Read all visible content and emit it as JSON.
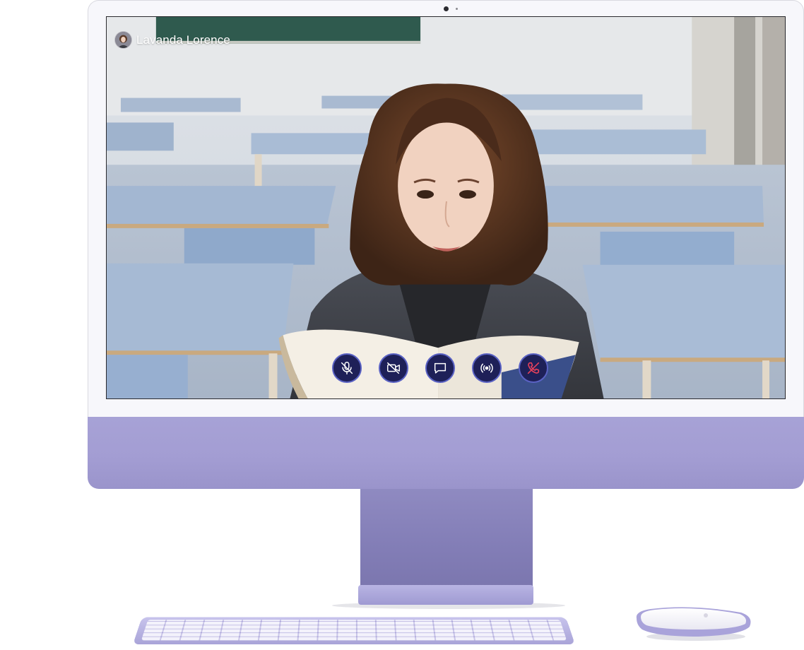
{
  "call": {
    "caller_name": "Lavanda Lorence",
    "controls": [
      {
        "name": "mute-mic-button",
        "icon": "mic-off-icon"
      },
      {
        "name": "toggle-camera-button",
        "icon": "video-off-icon"
      },
      {
        "name": "chat-button",
        "icon": "chat-bubble-icon"
      },
      {
        "name": "broadcast-button",
        "icon": "broadcast-icon"
      },
      {
        "name": "end-call-button",
        "icon": "phone-hangup-icon"
      }
    ]
  },
  "colors": {
    "control_background": "#1e2058",
    "control_ring": "#5a62c4",
    "hangup_icon": "#e8415b",
    "device_lavender": "#a39dd3"
  }
}
